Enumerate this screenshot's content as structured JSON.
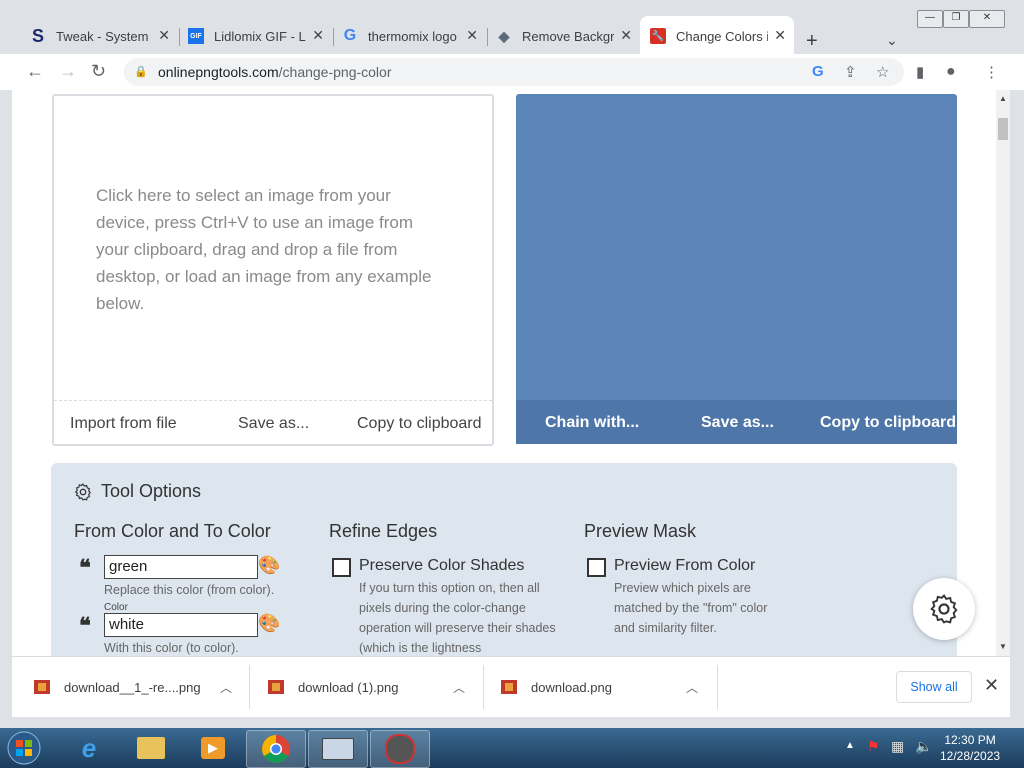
{
  "browser": {
    "tabs": [
      {
        "title": "Tweak - System T",
        "favicon": "S",
        "favicon_color": "#1a2a6c",
        "active": false
      },
      {
        "title": "Lidlomix GIF - Lid",
        "favicon": "GIF",
        "favicon_color": "#1a73e8",
        "active": false
      },
      {
        "title": "thermomix logo",
        "favicon": "G",
        "favicon_color": "#4285f4",
        "active": false
      },
      {
        "title": "Remove Backgro",
        "favicon": "◆",
        "favicon_color": "#5a6a7a",
        "active": false
      },
      {
        "title": "Change Colors in",
        "favicon": "🔧",
        "favicon_color": "#d93025",
        "active": true
      }
    ],
    "url_domain": "onlinepngtools.com",
    "url_path": "/change-png-color"
  },
  "left_panel": {
    "prompt": "Click here to select an image from your device, press Ctrl+V to use an image from your clipboard, drag and drop a file from desktop, or load an image from any example below.",
    "footer": [
      "Import from file",
      "Save as...",
      "Copy to clipboard"
    ]
  },
  "right_panel": {
    "color": "#5b84b8",
    "footer": [
      "Chain with...",
      "Save as...",
      "Copy to clipboard"
    ]
  },
  "tool_options": {
    "title": "Tool Options",
    "columns": {
      "colors": {
        "title": "From Color and To Color",
        "from_value": "green",
        "from_hint": "Replace this color (from color).",
        "to_label": "Color",
        "to_value": "white",
        "to_hint": "With this color (to color)."
      },
      "edges": {
        "title": "Refine Edges",
        "checkbox_label": "Preserve Color Shades",
        "description": "If you turn this option on, then all pixels during the color-change operation will preserve their shades (which is the lightness"
      },
      "mask": {
        "title": "Preview Mask",
        "checkbox_label": "Preview From Color",
        "description": "Preview which pixels are matched by the \"from\" color and similarity filter."
      }
    }
  },
  "downloads": {
    "items": [
      "download__1_-re....png",
      "download (1).png",
      "download.png"
    ],
    "show_all": "Show all"
  },
  "taskbar": {
    "time": "12:30 PM",
    "date": "12/28/2023"
  }
}
